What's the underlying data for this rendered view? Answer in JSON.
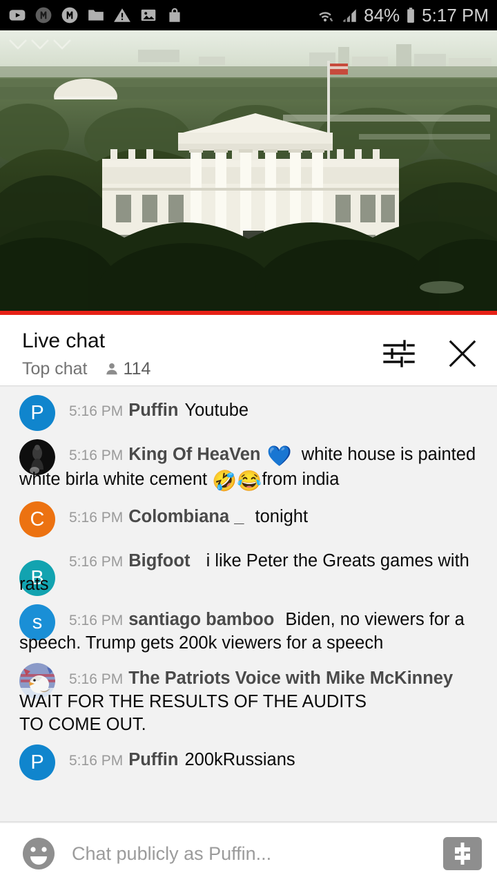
{
  "status_bar": {
    "left_icons": [
      {
        "name": "youtube-icon"
      },
      {
        "name": "m-badge-dim-icon"
      },
      {
        "name": "m-badge-icon"
      },
      {
        "name": "folder-icon"
      },
      {
        "name": "warning-triangle-icon"
      },
      {
        "name": "image-icon"
      },
      {
        "name": "shopping-bag-icon"
      }
    ],
    "wifi_icon": "wifi-data-transfer-icon",
    "signal_icon": "cellular-signal-icon",
    "battery_percent": "84%",
    "battery_icon": "battery-icon",
    "clock": "5:17 PM"
  },
  "video": {
    "alt": "white-house-live-webcam",
    "progress_percent": 100,
    "progress_color": "#e62117"
  },
  "chat_header": {
    "title": "Live chat",
    "mode": "Top chat",
    "viewer_count": "114",
    "viewers_icon": "person-icon",
    "filter_icon": "chat-filter-icon",
    "close_icon": "close-icon"
  },
  "messages": [
    {
      "avatar": {
        "type": "letter",
        "letter": "P",
        "color": "#1085cd"
      },
      "timestamp": "5:16 PM",
      "author": "Puffin",
      "text": "Youtube",
      "emojis": []
    },
    {
      "avatar": {
        "type": "photo",
        "style": "dark-figure"
      },
      "timestamp": "5:16 PM",
      "author": "King Of HeaVen",
      "text_before_emoji": "",
      "emoji_1": "💙",
      "text": "white house is painted white birla white cement",
      "emoji_2": "🤣",
      "emoji_3": "😂",
      "text_after": "from india"
    },
    {
      "avatar": {
        "type": "letter",
        "letter": "C",
        "color": "#ec7211"
      },
      "timestamp": "5:16 PM",
      "author": "Colombiana _",
      "text": "tonight",
      "emojis": []
    },
    {
      "avatar": {
        "type": "letter",
        "letter": "B",
        "color": "#12a3b0"
      },
      "timestamp": "5:16 PM",
      "author": "Bigfoot",
      "text": "i like Peter the Greats games with rats",
      "emojis": []
    },
    {
      "avatar": {
        "type": "letter",
        "letter": "s",
        "color": "#1a8fd6"
      },
      "timestamp": "5:16 PM",
      "author": "santiago bamboo",
      "text": "Biden, no viewers for a speech. Trump gets 200k viewers for a speech",
      "emojis": []
    },
    {
      "avatar": {
        "type": "photo",
        "style": "eagle-flag"
      },
      "timestamp": "5:16 PM",
      "author": "The Patriots Voice with Mike McKinney",
      "text_line_1": "WAIT FOR THE RESULTS OF THE AUDITS",
      "text_line_2": "TO COME OUT.",
      "emojis": []
    },
    {
      "avatar": {
        "type": "letter",
        "letter": "P",
        "color": "#1085cd"
      },
      "timestamp": "5:16 PM",
      "author": "Puffin",
      "text": "200kRussians",
      "emojis": []
    }
  ],
  "composer": {
    "emoji_icon": "emoji-smiley-icon",
    "placeholder": "Chat publicly as Puffin...",
    "input_value": "",
    "superchat_icon": "dollar-sign-icon"
  }
}
